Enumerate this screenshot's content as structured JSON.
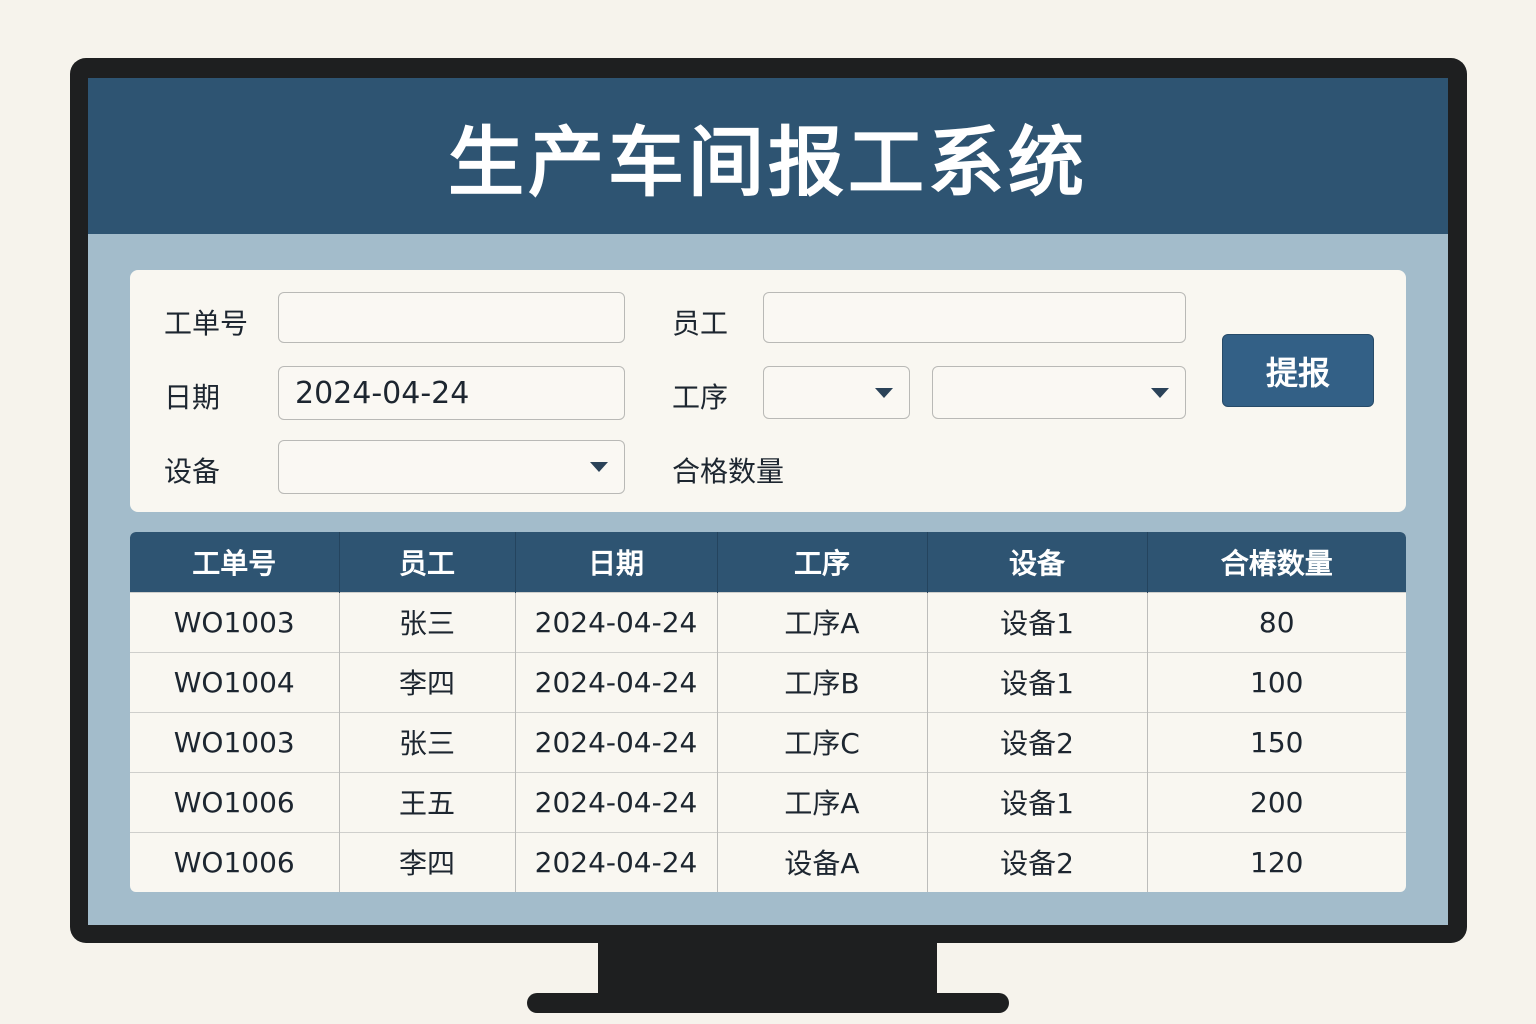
{
  "title": "生产车间报工系统",
  "form": {
    "order_no_label": "工单号",
    "order_no_value": "",
    "employee_label": "员工",
    "employee_value": "",
    "date_label": "日期",
    "date_value": "2024-04-24",
    "process_label": "工序",
    "process_value_1": "",
    "process_value_2": "",
    "equipment_label": "设备",
    "equipment_value": "",
    "qty_label": "合格数量",
    "submit_label": "提报"
  },
  "table": {
    "headers": [
      "工单号",
      "员工",
      "日期",
      "工序",
      "设备",
      "合椿数量"
    ],
    "rows": [
      [
        "WO1003",
        "张三",
        "2024-04-24",
        "工序A",
        "设备1",
        "80"
      ],
      [
        "WO1004",
        "李四",
        "2024-04-24",
        "工序B",
        "设备1",
        "100"
      ],
      [
        "WO1003",
        "张三",
        "2024-04-24",
        "工序C",
        "设备2",
        "150"
      ],
      [
        "WO1006",
        "王五",
        "2024-04-24",
        "工序A",
        "设备1",
        "200"
      ],
      [
        "WO1006",
        "李四",
        "2024-04-24",
        "设备A",
        "设备2",
        "120"
      ]
    ]
  }
}
